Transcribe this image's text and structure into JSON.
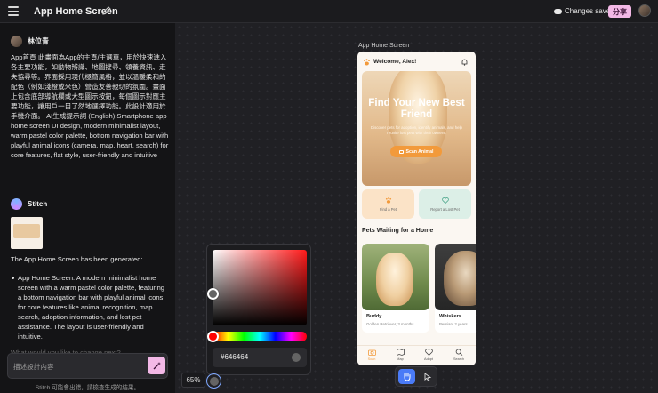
{
  "topbar": {
    "title": "App Home Screen",
    "changes_status": "Changes save",
    "share_label": "分享"
  },
  "chat": {
    "user_name": "林位青",
    "prompt": "App首頁 此畫面為App的主頁/主選單，用於快速進入各主要功能，如動物辨識、地圖搜尋、領養資訊、走失協尋等。界面採用現代極簡風格，並以溫暖柔和的配色（例如淺橙或米色）營造友善親切的氛圍。畫面上包含底部導航欄或大型圖示按鈕，每個圖示對應主要功能，讓用戶一目了然地選擇功能。此設計適用於手機介面。 AI生成提示詞 (English):Smartphone app home screen UI design, modern minimalist layout, warm pastel color palette, bottom navigation bar with playful animal icons (camera, map, heart, search) for core features, flat style, user-friendly and intuitive",
    "assistant_name": "Stitch",
    "generated_text": "The App Home Screen has been generated:",
    "bullet": "App Home Screen: A modern minimalist home screen with a warm pastel color palette, featuring a bottom navigation bar with playful animal icons for core features like animal recognition, map search, adoption information, and lost pet assistance. The layout is user-friendly and intuitive.",
    "faded_text": "What would you like to change next?",
    "input_placeholder": "描述設計內容",
    "footer_note": "Stitch 可能會出錯，請檢查生成的結果。"
  },
  "canvas": {
    "frame_label": "App Home Screen",
    "zoom": "65%"
  },
  "phone": {
    "welcome": "Welcome, Alex!",
    "hero_title": "Find Your New Best Friend",
    "hero_sub": "Discover pets for adoption, identify animals, and help reunite lost pets with their owners.",
    "scan_label": "Scan Animal",
    "feature_find": "Find a Pet",
    "feature_lost": "Report a Lost Pet",
    "section_title": "Pets Waiting for a Home",
    "pets": [
      {
        "name": "Buddy",
        "breed": "Golden Retriever, 3 months"
      },
      {
        "name": "Whiskers",
        "breed": "Persian, 2 years"
      }
    ],
    "nav": [
      "Scan",
      "Map",
      "Adopt",
      "Search"
    ],
    "accent_color": "#f29a3b"
  },
  "picker": {
    "hex": "#646464"
  }
}
